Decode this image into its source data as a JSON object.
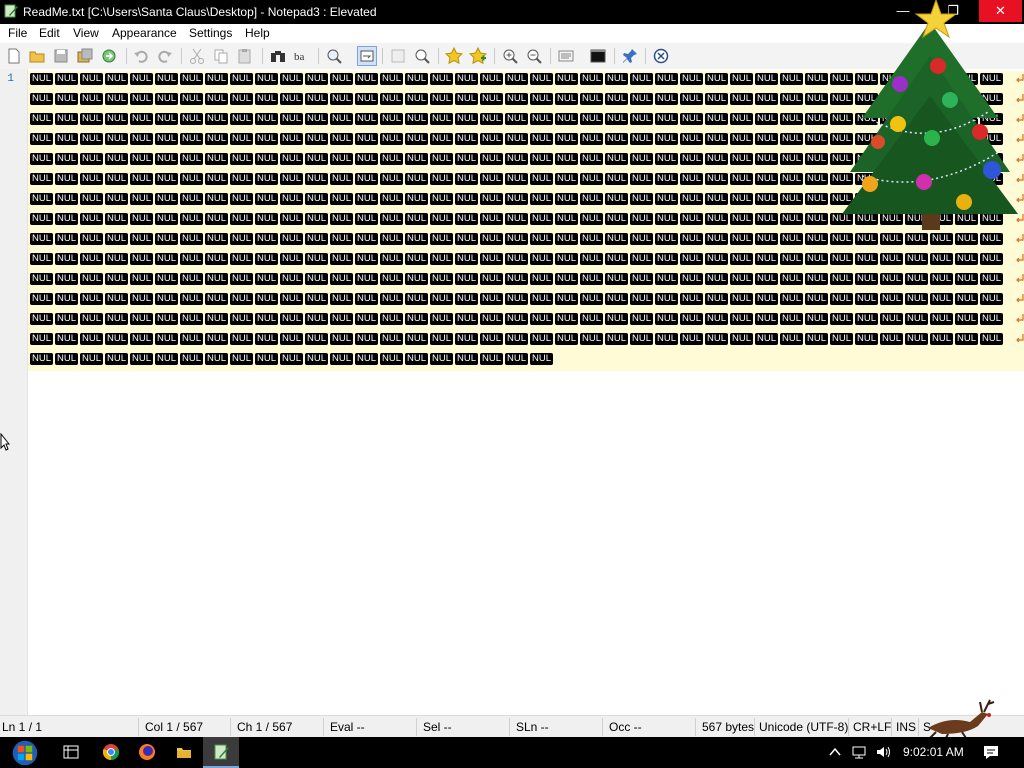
{
  "window": {
    "title": "ReadMe.txt [C:\\Users\\Santa Claus\\Desktop] - Notepad3 : Elevated",
    "minimize_glyph": "—",
    "maximize_glyph": "❐",
    "close_glyph": "✕"
  },
  "menu": [
    "File",
    "Edit",
    "View",
    "Appearance",
    "Settings",
    "Help"
  ],
  "toolbar": {
    "buttons": [
      "new-file-icon",
      "open-folder-icon",
      "save-icon",
      "save-as-icon",
      "reload-icon",
      "undo-icon",
      "redo-icon",
      "cut-icon",
      "copy-icon",
      "paste-icon",
      "find-icon",
      "replace-icon",
      "find-in-files-icon",
      "word-wrap-icon",
      "goto-icon",
      "zoom-icon",
      "add-favorite-icon",
      "favorites-icon",
      "zoom-in-icon",
      "zoom-out-icon",
      "view-whitespace-icon",
      "terminal-icon",
      "pin-icon",
      "exit-icon"
    ]
  },
  "editor": {
    "line_number": "1",
    "nul_token": "NUL",
    "full_row_count": 14,
    "tokens_per_full_row": 39,
    "last_row_tokens": 21,
    "line_highlight_color": "#fffbd6"
  },
  "statusbar": {
    "ln": "Ln 1 / 1",
    "col": "Col  1 / 567",
    "ch": "Ch  1 / 567",
    "eval": "Eval  --",
    "sel": "Sel  --",
    "sln": "SLn  --",
    "occ": "Occ  --",
    "size": "567 bytes",
    "encoding": "Unicode (UTF-8)",
    "eol": "CR+LF",
    "mode": "INS",
    "extra": "S"
  },
  "taskbar": {
    "apps": [
      "start-orb-icon",
      "task-view-icon",
      "chrome-icon",
      "firefox-icon",
      "file-explorer-icon",
      "notepad3-icon"
    ],
    "clock": "9:02:01 AM"
  },
  "colors": {
    "titlebar": "#000000",
    "close_button": "#e81123",
    "nul_background": "#000000",
    "nul_text": "#ffffff"
  }
}
